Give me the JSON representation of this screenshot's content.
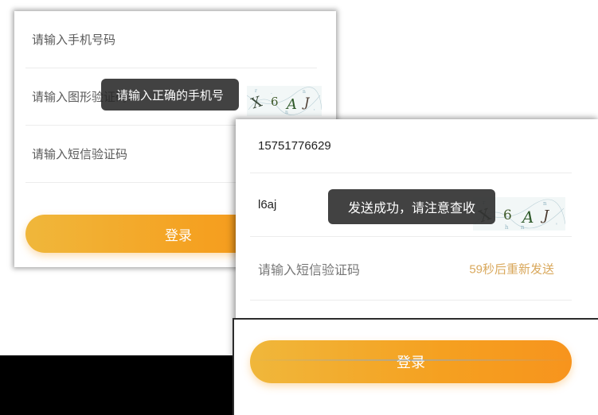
{
  "panel_back": {
    "phone_placeholder": "请输入手机号码",
    "captcha_placeholder": "请输入图形验证码",
    "sms_placeholder": "请输入短信验证码",
    "login_label": "登录",
    "toast": "请输入正确的手机号",
    "captcha_chars": "X6AJ"
  },
  "panel_front": {
    "phone_value": "15751776629",
    "captcha_value": "l6aj",
    "sms_placeholder": "请输入短信验证码",
    "resend_label": "59秒后重新发送",
    "login_label": "登录",
    "toast": "发送成功，请注意查收",
    "captcha_chars": "X6AJ"
  },
  "colors": {
    "accent_start": "#f0b73b",
    "accent_end": "#f7941d",
    "resend_text": "#d9a85c",
    "toast_bg": "#333333"
  }
}
